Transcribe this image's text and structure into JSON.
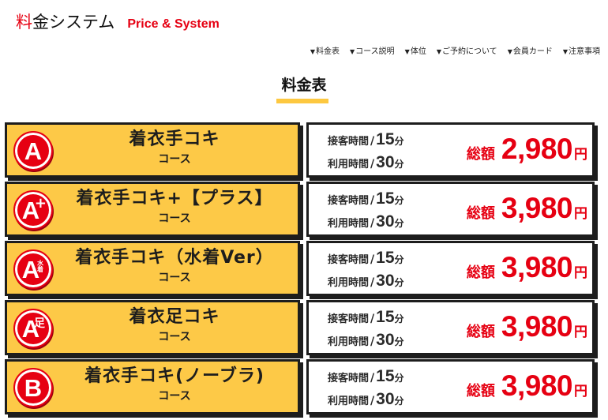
{
  "header": {
    "title_accent": "料",
    "title_rest": "金システム",
    "subtitle": "Price & System"
  },
  "nav": {
    "marker": "▼",
    "items": [
      {
        "label": "料金表"
      },
      {
        "label": "コース説明"
      },
      {
        "label": "体位"
      },
      {
        "label": "ご予約について"
      },
      {
        "label": "会員カード"
      },
      {
        "label": "注意事項"
      }
    ]
  },
  "section": {
    "title": "料金表",
    "underline_color": "#fdc840"
  },
  "colors": {
    "accent_red": "#e60012",
    "course_yellow": "#fdc947",
    "border_dark": "#1d1d1d"
  },
  "labels": {
    "service_time": "接客時間",
    "usage_time": "利用時間",
    "slash": "/",
    "minute_unit": "分",
    "total_label": "総額",
    "yen_unit": "円",
    "course_suffix": "コース"
  },
  "courses": [
    {
      "badge_letter": "A",
      "badge_sup": "",
      "name": "着衣手コキ",
      "sub": "コース",
      "service_minutes": "15",
      "usage_minutes": "30",
      "price": "2,980"
    },
    {
      "badge_letter": "A",
      "badge_sup": "+",
      "name": "着衣手コキ+【プラス】",
      "sub": "コース",
      "service_minutes": "15",
      "usage_minutes": "30",
      "price": "3,980"
    },
    {
      "badge_letter": "A",
      "badge_sup": "水着",
      "name": "着衣手コキ（水着Ver）",
      "sub": "コース",
      "service_minutes": "15",
      "usage_minutes": "30",
      "price": "3,980"
    },
    {
      "badge_letter": "A",
      "badge_sup": "足",
      "name": "着衣足コキ",
      "sub": "コース",
      "service_minutes": "15",
      "usage_minutes": "30",
      "price": "3,980"
    },
    {
      "badge_letter": "B",
      "badge_sup": "",
      "name": "着衣手コキ(ノーブラ)",
      "sub": "コース",
      "service_minutes": "15",
      "usage_minutes": "30",
      "price": "3,980"
    }
  ]
}
